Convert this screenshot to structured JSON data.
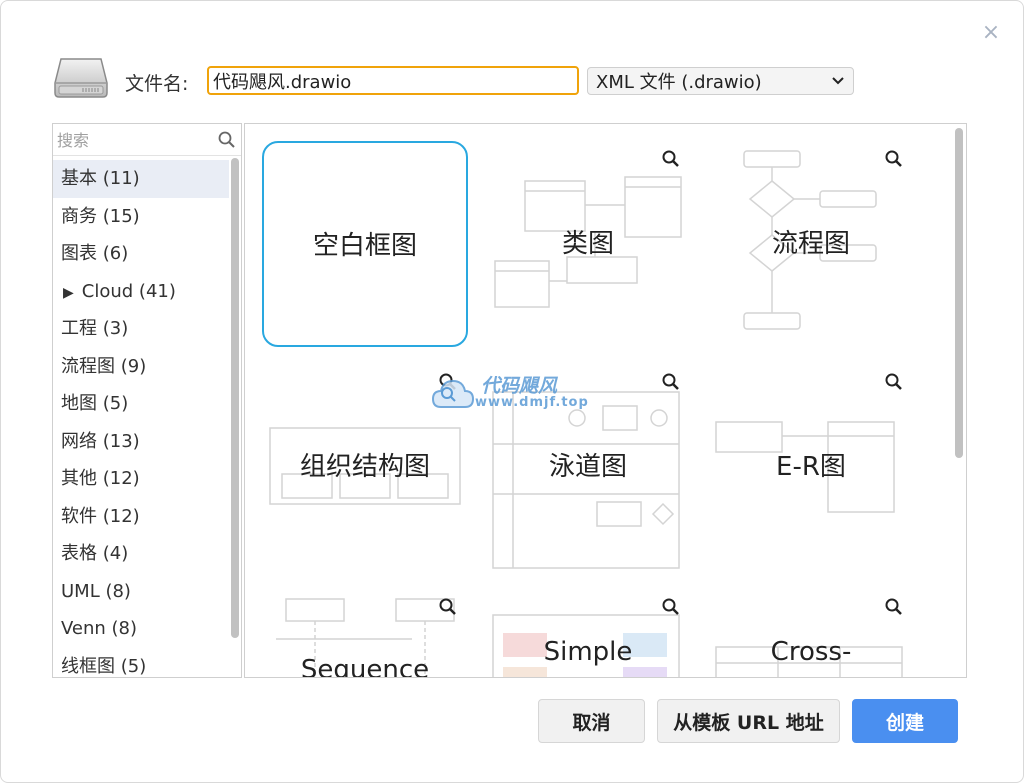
{
  "dialog": {
    "close_glyph": "×",
    "file_label": "文件名:",
    "file_value": "代码飓风.drawio",
    "format_value": "XML 文件 (.drawio)",
    "format_chevron": "⌄"
  },
  "sidebar": {
    "search_placeholder": "搜索",
    "categories": [
      "基本 (11)",
      "商务 (15)",
      "图表 (6)",
      "Cloud (41)",
      "工程 (3)",
      "流程图 (9)",
      "地图 (5)",
      "网络 (13)",
      "其他 (12)",
      "软件 (12)",
      "表格 (4)",
      "UML (8)",
      "Venn (8)",
      "线框图 (5)"
    ],
    "cloud_triangle": "▶"
  },
  "templates": [
    {
      "label": "空白框图"
    },
    {
      "label": "类图"
    },
    {
      "label": "流程图"
    },
    {
      "label": "组织结构图"
    },
    {
      "label": "泳道图"
    },
    {
      "label": "E-R图"
    },
    {
      "label": "Sequence"
    },
    {
      "label": "Simple"
    },
    {
      "label": "Cross-"
    }
  ],
  "watermark": {
    "title": "代码飓风",
    "url": "www.dmjf.top"
  },
  "buttons": {
    "cancel": "取消",
    "from_url": "从模板 URL 地址",
    "create": "创建"
  },
  "colors": {
    "accent": "#4a8ff0",
    "selected_border": "#29a8e0",
    "input_focus": "#f0a30a"
  }
}
